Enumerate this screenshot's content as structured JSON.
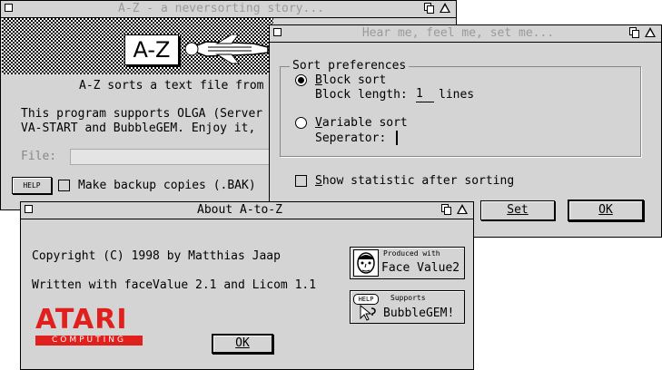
{
  "az_window": {
    "title": "A-Z - a neversorting story...",
    "logo_text": "A-Z",
    "description_line": "A-Z sorts a text file from",
    "support_line1": "This program supports OLGA (Server",
    "support_line2": "VA-START and BubbleGEM. Enjoy it,",
    "file_label": "File:",
    "help_label": "HELP",
    "backup_label": "Make backup copies (.BAK)",
    "backup_checked": false
  },
  "prefs_window": {
    "title": "Hear me, feel me, set me...",
    "group_title": "Sort preferences",
    "block_sort_label": "Block sort",
    "block_sort_selected": true,
    "block_length_label": "Block length:",
    "block_length_value": "1",
    "lines_label": "lines",
    "variable_sort_label": "Variable sort",
    "variable_sort_selected": false,
    "separator_label": "Seperator:",
    "separator_value": "",
    "statistic_label": "Show statistic after sorting",
    "statistic_checked": false,
    "set_label": "Set",
    "ok_label": "OK"
  },
  "about_window": {
    "title": "About A-to-Z",
    "copyright": "Copyright (C) 1998 by Matthias Jaap",
    "written_with": "Written with faceValue 2.1 and Licom 1.1",
    "atari_logo": "ATARI",
    "atari_sub": "COMPUTING",
    "produced_caption": "Produced with",
    "produced_name": "Face Value2",
    "supports_caption": "Supports",
    "supports_name": "BubbleGEM!",
    "supports_icon_label": "HELP",
    "ok_label": "OK"
  },
  "colors": {
    "window_bg": "#d4d4d4",
    "atari_red": "#e0201c",
    "inactive_title": "#9a9a9a"
  }
}
